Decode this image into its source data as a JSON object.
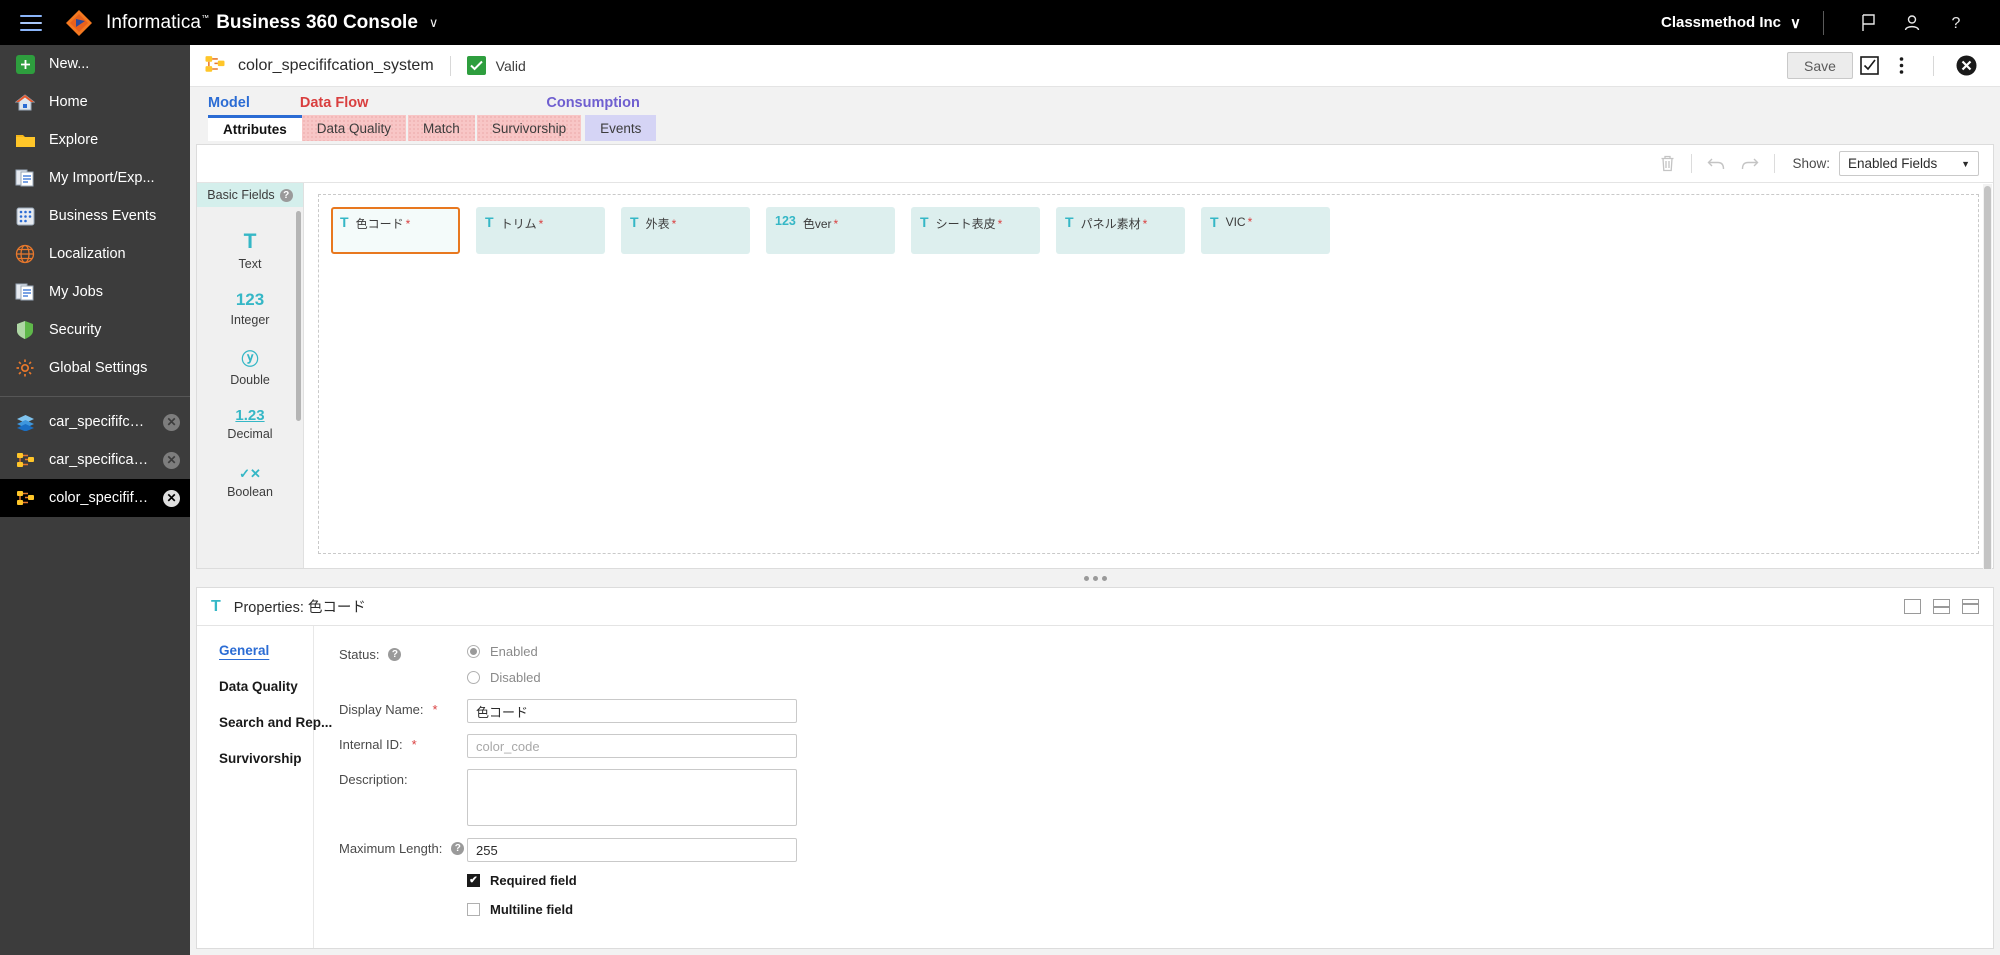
{
  "topbar": {
    "menu_icon": "hamburger-icon",
    "brand": "Informatica",
    "brand_tm": "™",
    "app_name": "Business 360 Console",
    "app_chevron": "∨",
    "org": "Classmethod Inc",
    "org_chevron": "∨",
    "icons": [
      "flag-icon",
      "user-icon",
      "help-icon"
    ]
  },
  "sidebar": {
    "items": [
      {
        "label": "New...",
        "icon": "new-plus-icon"
      },
      {
        "label": "Home",
        "icon": "home-icon"
      },
      {
        "label": "Explore",
        "icon": "folder-icon"
      },
      {
        "label": "My Import/Exp...",
        "icon": "import-export-icon"
      },
      {
        "label": "Business Events",
        "icon": "business-events-icon"
      },
      {
        "label": "Localization",
        "icon": "globe-icon"
      },
      {
        "label": "My Jobs",
        "icon": "jobs-icon"
      },
      {
        "label": "Security",
        "icon": "shield-icon"
      },
      {
        "label": "Global Settings",
        "icon": "gear-icon"
      }
    ],
    "documents": [
      {
        "label": "car_specififcatio...",
        "icon": "layers-icon",
        "active": false,
        "close": "✕"
      },
      {
        "label": "car_specification...",
        "icon": "model-icon",
        "active": false,
        "close": "✕"
      },
      {
        "label": "color_specififcati...",
        "icon": "model-icon",
        "active": true,
        "close": "✕"
      }
    ]
  },
  "doc_header": {
    "icon": "model-icon",
    "title": "color_specififcation_system",
    "status_icon": "check-icon",
    "status_label": "Valid",
    "save_label": "Save",
    "validate_icon": "validate-checkbox-icon",
    "more_icon": "kebab-menu-icon",
    "close_icon": "close-icon"
  },
  "tabs_primary": [
    {
      "label": "Model",
      "color": "#2b6cd4",
      "selected": true
    },
    {
      "label": "Data Flow",
      "color": "#d93f3f",
      "selected": false
    },
    {
      "label": "Consumption",
      "color": "#6f5fd0",
      "selected": false
    }
  ],
  "tabs_secondary": [
    {
      "label": "Attributes",
      "group": "model",
      "selected": true
    },
    {
      "label": "Data Quality",
      "group": "dataflow",
      "selected": false
    },
    {
      "label": "Match",
      "group": "dataflow",
      "selected": false
    },
    {
      "label": "Survivorship",
      "group": "dataflow",
      "selected": false
    },
    {
      "label": "Events",
      "group": "consumption",
      "selected": false
    }
  ],
  "canvas_toolbar": {
    "delete_icon": "trash-icon",
    "undo_icon": "undo-icon",
    "redo_icon": "redo-icon",
    "show_label": "Show:",
    "show_value": "Enabled Fields",
    "show_chevron": "▼"
  },
  "palette": {
    "header": "Basic Fields",
    "help_icon": "help-icon",
    "help_glyph": "?",
    "items": [
      {
        "label": "Text",
        "glyph": "T",
        "icon": "text-type-icon"
      },
      {
        "label": "Integer",
        "glyph": "123",
        "icon": "integer-type-icon"
      },
      {
        "label": "Double",
        "glyph": "ⓨ",
        "icon": "double-type-icon"
      },
      {
        "label": "Decimal",
        "glyph": "1.23",
        "icon": "decimal-type-icon"
      },
      {
        "label": "Boolean",
        "glyph": "✓✕",
        "icon": "boolean-type-icon"
      }
    ]
  },
  "fields": [
    {
      "label": "色コード",
      "type": "T",
      "required": "*",
      "selected": true
    },
    {
      "label": "トリム",
      "type": "T",
      "required": "*",
      "selected": false
    },
    {
      "label": "外表",
      "type": "T",
      "required": "*",
      "selected": false
    },
    {
      "label": "色ver",
      "type": "123",
      "required": "*",
      "selected": false
    },
    {
      "label": "シート表皮",
      "type": "T",
      "required": "*",
      "selected": false
    },
    {
      "label": "パネル素材",
      "type": "T",
      "required": "*",
      "selected": false
    },
    {
      "label": "VIC",
      "type": "T",
      "required": "*",
      "selected": false
    }
  ],
  "properties": {
    "header_icon": "text-type-icon",
    "header_glyph": "T",
    "title": "Properties: 色コード",
    "layout_icons": [
      "panel-single-icon",
      "panel-split-icon",
      "panel-top-icon"
    ],
    "nav": [
      {
        "label": "General",
        "selected": true
      },
      {
        "label": "Data Quality",
        "selected": false
      },
      {
        "label": "Search and Rep...",
        "selected": false
      },
      {
        "label": "Survivorship",
        "selected": false
      }
    ],
    "form": {
      "status_label": "Status:",
      "status_help": "?",
      "status_options": [
        {
          "label": "Enabled",
          "checked": true
        },
        {
          "label": "Disabled",
          "checked": false
        }
      ],
      "display_name_label": "Display Name:",
      "display_name_value": "色コード",
      "internal_id_label": "Internal ID:",
      "internal_id_value": "color_code",
      "description_label": "Description:",
      "description_value": "",
      "max_length_label": "Maximum Length:",
      "max_length_help": "?",
      "max_length_value": "255",
      "required_field_label": "Required field",
      "required_field_checked": true,
      "multiline_field_label": "Multiline field",
      "multiline_field_checked": false,
      "check_glyph": "✔"
    }
  },
  "colors": {
    "accent_blue": "#2b6cd4",
    "accent_red": "#d93f3f",
    "accent_purple": "#6f5fd0",
    "teal": "#35b7c6",
    "card_bg": "#ddefee",
    "selected_border": "#e8781f",
    "valid_green": "#2e9e3e"
  }
}
